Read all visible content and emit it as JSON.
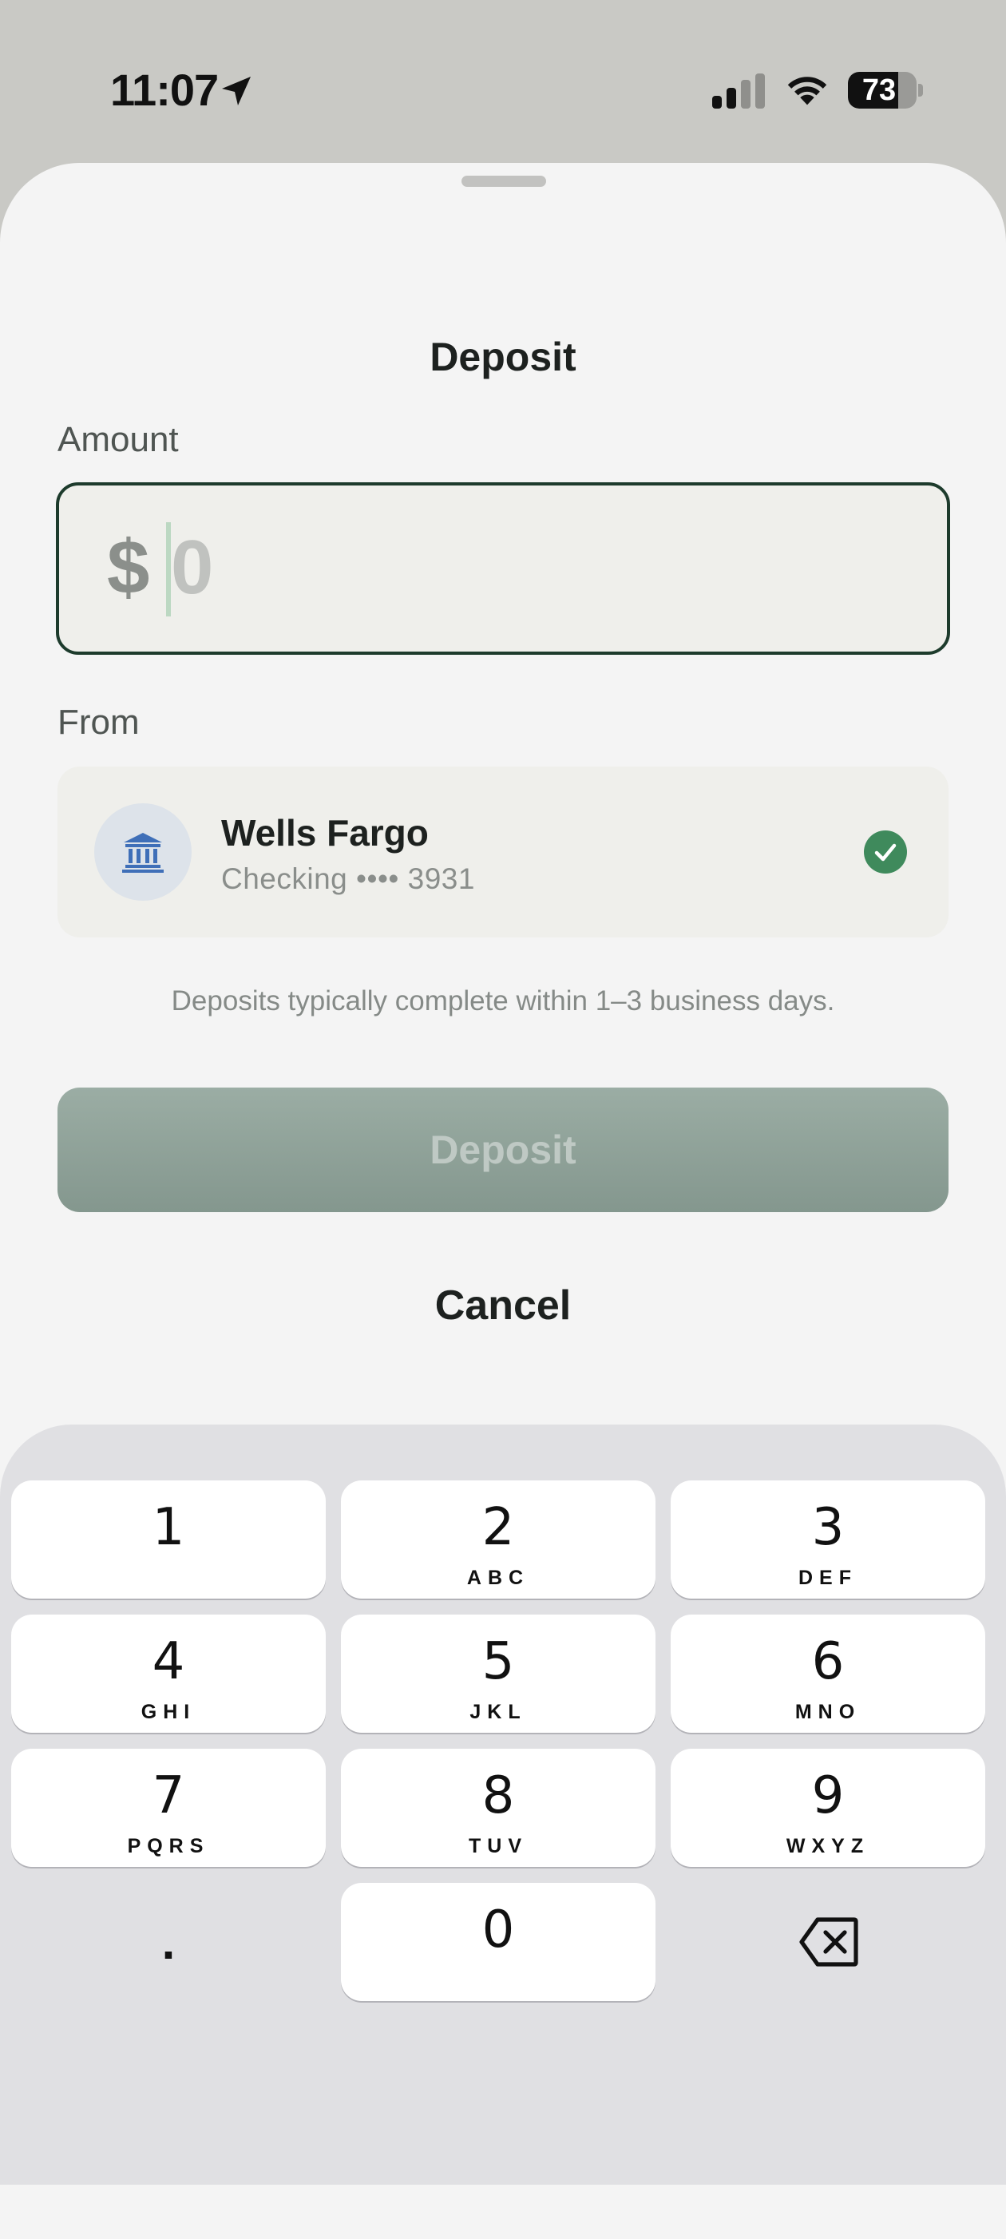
{
  "status_bar": {
    "time": "11:07",
    "battery": "73",
    "battery_level": 0.73,
    "icons": [
      "location-arrow-icon",
      "cellular-signal-icon",
      "wifi-icon",
      "battery-icon"
    ]
  },
  "sheet": {
    "title": "Deposit",
    "amount_label": "Amount",
    "currency_symbol": "$",
    "amount_placeholder": "0",
    "from_label": "From",
    "account": {
      "bank_name": "Wells Fargo",
      "account_detail": "Checking •••• 3931",
      "selected": true,
      "icon": "bank-icon"
    },
    "info_text": "Deposits typically complete within 1–3 business days.",
    "deposit_button": "Deposit",
    "cancel_button": "Cancel"
  },
  "colors": {
    "accent_dark": "#1d3b2c",
    "check_green": "#3f8a5c",
    "button_disabled": "#8ea198"
  },
  "keyboard": {
    "keys": [
      {
        "digit": "1",
        "letters": ""
      },
      {
        "digit": "2",
        "letters": "ABC"
      },
      {
        "digit": "3",
        "letters": "DEF"
      },
      {
        "digit": "4",
        "letters": "GHI"
      },
      {
        "digit": "5",
        "letters": "JKL"
      },
      {
        "digit": "6",
        "letters": "MNO"
      },
      {
        "digit": "7",
        "letters": "PQRS"
      },
      {
        "digit": "8",
        "letters": "TUV"
      },
      {
        "digit": "9",
        "letters": "WXYZ"
      },
      {
        "digit": ".",
        "letters": ""
      },
      {
        "digit": "0",
        "letters": ""
      },
      {
        "digit": "delete",
        "letters": ""
      }
    ]
  }
}
